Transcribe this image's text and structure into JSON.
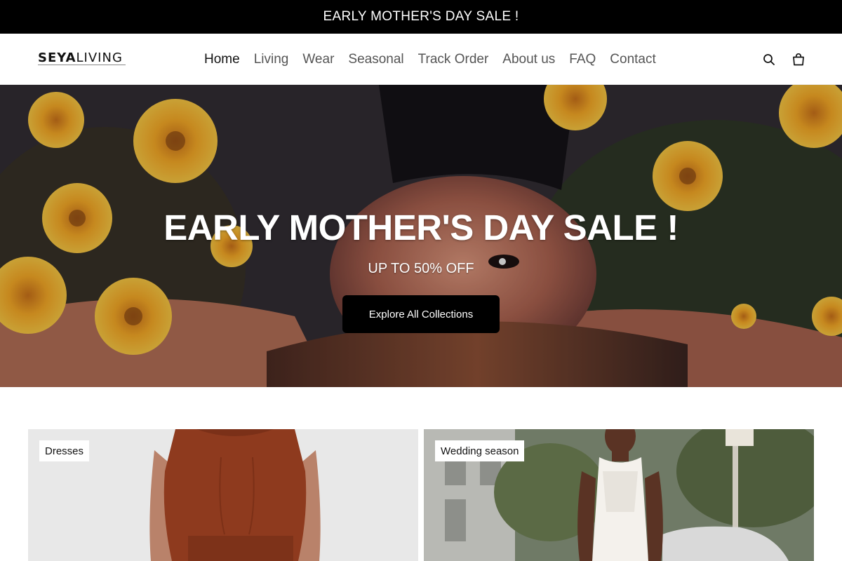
{
  "announcement": {
    "text": "EARLY MOTHER'S DAY SALE !"
  },
  "header": {
    "logo": {
      "part_bold": "SEYA",
      "part_light": "LIVING"
    },
    "nav": [
      {
        "label": "Home",
        "active": true
      },
      {
        "label": "Living"
      },
      {
        "label": "Wear"
      },
      {
        "label": "Seasonal"
      },
      {
        "label": "Track Order"
      },
      {
        "label": "About us"
      },
      {
        "label": "FAQ"
      },
      {
        "label": "Contact"
      }
    ],
    "icons": {
      "search": "search-icon",
      "cart": "shopping-bag-icon"
    }
  },
  "hero": {
    "title": "EARLY MOTHER'S DAY SALE !",
    "subtitle": "UP TO 50% OFF",
    "button_label": "Explore All Collections"
  },
  "collections": [
    {
      "label": "Dresses"
    },
    {
      "label": "Wedding season"
    }
  ],
  "colors": {
    "announcement_bg": "#000000",
    "button_bg": "#000000",
    "text": "#121212",
    "nav_muted": "#555555"
  }
}
